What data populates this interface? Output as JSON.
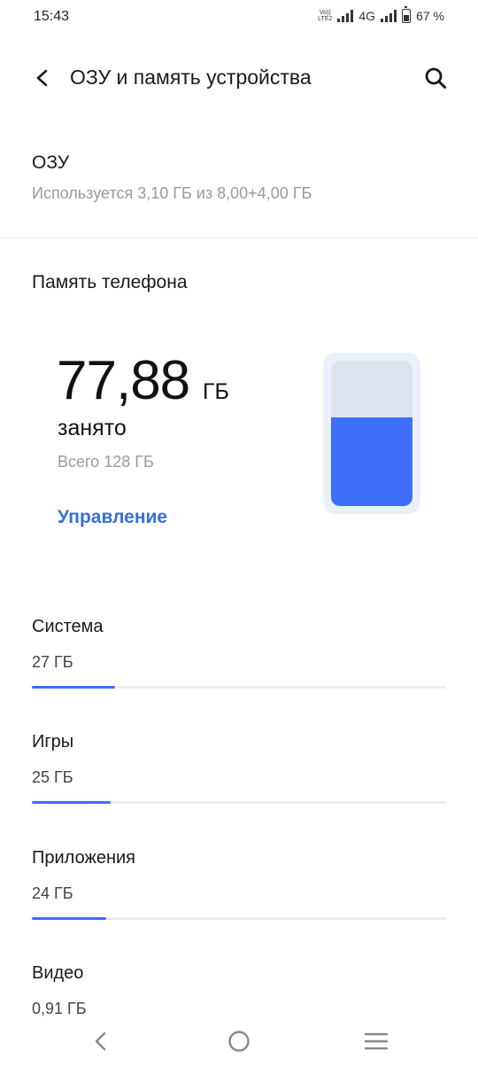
{
  "status": {
    "time": "15:43",
    "volte_top": "Vo))",
    "volte_bottom": "LTE2",
    "network": "4G",
    "battery": "67 %",
    "battery_level": 0.67
  },
  "header": {
    "title": "ОЗУ и память устройства"
  },
  "ram": {
    "label": "ОЗУ",
    "usage": "Используется 3,10 ГБ из 8,00+4,00 ГБ"
  },
  "storage": {
    "label": "Память телефона",
    "used_value": "77,88",
    "used_unit": "ГБ",
    "used_word": "занято",
    "total": "Всего 128 ГБ",
    "manage": "Управление",
    "used_fraction": 0.608
  },
  "categories": [
    {
      "name": "Система",
      "size": "27 ГБ",
      "fraction": 0.2
    },
    {
      "name": "Игры",
      "size": "25 ГБ",
      "fraction": 0.19
    },
    {
      "name": "Приложения",
      "size": "24 ГБ",
      "fraction": 0.18
    },
    {
      "name": "Видео",
      "size": "0,91 ГБ",
      "fraction": 0.01
    }
  ],
  "colors": {
    "accent": "#3d6efc",
    "link": "#3b6fd6"
  }
}
